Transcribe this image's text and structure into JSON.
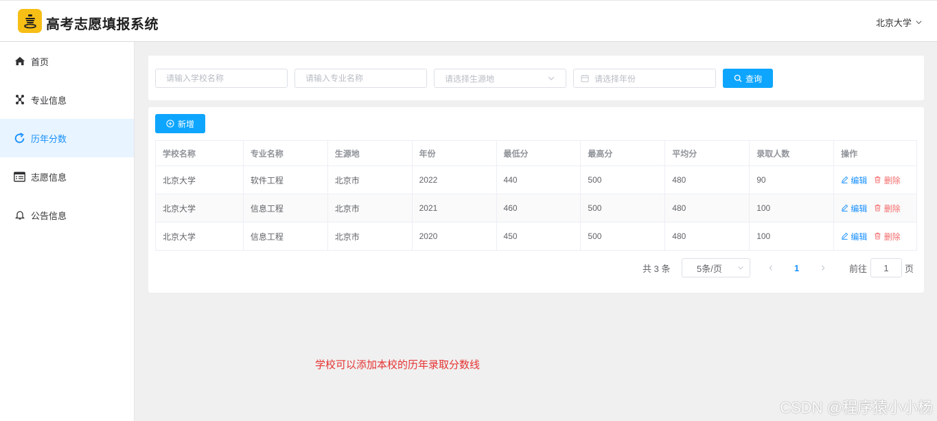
{
  "app": {
    "title": "高考志愿填报系统",
    "user": "北京大学"
  },
  "sidebar": {
    "items": [
      {
        "label": "首页",
        "icon": "home-icon",
        "active": false
      },
      {
        "label": "专业信息",
        "icon": "network-icon",
        "active": false
      },
      {
        "label": "历年分数",
        "icon": "refresh-icon",
        "active": true
      },
      {
        "label": "志愿信息",
        "icon": "list-card-icon",
        "active": false
      },
      {
        "label": "公告信息",
        "icon": "bell-icon",
        "active": false
      }
    ]
  },
  "search": {
    "school_placeholder": "请输入学校名称",
    "major_placeholder": "请输入专业名称",
    "origin_placeholder": "请选择生源地",
    "year_placeholder": "请选择年份",
    "query_label": "查询"
  },
  "toolbar": {
    "add_label": "新增"
  },
  "table": {
    "columns": [
      "学校名称",
      "专业名称",
      "生源地",
      "年份",
      "最低分",
      "最高分",
      "平均分",
      "录取人数",
      "操作"
    ],
    "rows": [
      [
        "北京大学",
        "软件工程",
        "北京市",
        "2022",
        "440",
        "500",
        "480",
        "90"
      ],
      [
        "北京大学",
        "信息工程",
        "北京市",
        "2021",
        "460",
        "500",
        "480",
        "100"
      ],
      [
        "北京大学",
        "信息工程",
        "北京市",
        "2020",
        "450",
        "500",
        "480",
        "100"
      ]
    ],
    "edit_label": "编辑",
    "delete_label": "删除"
  },
  "pagination": {
    "total": "共 3 条",
    "page_size": "5条/页",
    "current_page": "1",
    "goto_prefix": "前往",
    "goto_value": "1",
    "goto_suffix": "页"
  },
  "annotation": "学校可以添加本校的历年录取分数线",
  "watermark": "CSDN @程序猿小小杨",
  "colors": {
    "primary": "#0ea5ff",
    "danger": "#f56c6c",
    "logo": "#f7be16",
    "annotation": "#e63232"
  }
}
